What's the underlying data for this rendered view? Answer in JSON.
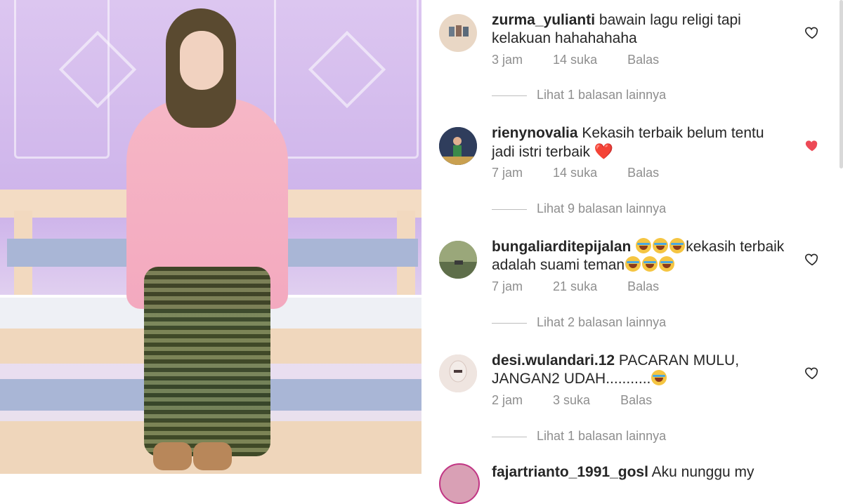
{
  "photo": {
    "alt": "Woman in pink outfit and olive hijab sitting on a pastel bench"
  },
  "comments": [
    {
      "username": "zurma_yulianti",
      "text": "bawain lagu religi tapi kelakuan hahahahaha",
      "emoji": "",
      "time": "3 jam",
      "likes": "14 suka",
      "reply": "Balas",
      "liked": false,
      "view_replies": "Lihat 1 balasan lainnya",
      "avatar_color": "#e9d7c5"
    },
    {
      "username": "rienynovalia",
      "text": "Kekasih terbaik belum tentu jadi istri terbaik",
      "emoji": "❤️",
      "time": "7 jam",
      "likes": "14 suka",
      "reply": "Balas",
      "liked": true,
      "view_replies": "Lihat 9 balasan lainnya",
      "avatar_color": "#3b4a6b"
    },
    {
      "username": "bungaliarditepijalan",
      "text_parts": [
        "kekasih terbaik adalah suami teman"
      ],
      "time": "7 jam",
      "likes": "21 suka",
      "reply": "Balas",
      "liked": false,
      "view_replies": "Lihat 2 balasan lainnya",
      "avatar_color": "#8a9a6a"
    },
    {
      "username": "desi.wulandari.12",
      "text": "PACARAN MULU, JANGAN2 UDAH...........",
      "time": "2 jam",
      "likes": "3 suka",
      "reply": "Balas",
      "liked": false,
      "view_replies": "Lihat 1 balasan lainnya",
      "avatar_color": "#e8d8d2"
    },
    {
      "username": "fajartrianto_1991_gosl",
      "text": "Aku nunggu my",
      "avatar_color": "#d9a0b5"
    }
  ],
  "colors": {
    "heart_liked": "#ed4956",
    "muted": "#8e8e8e",
    "text": "#262626"
  }
}
